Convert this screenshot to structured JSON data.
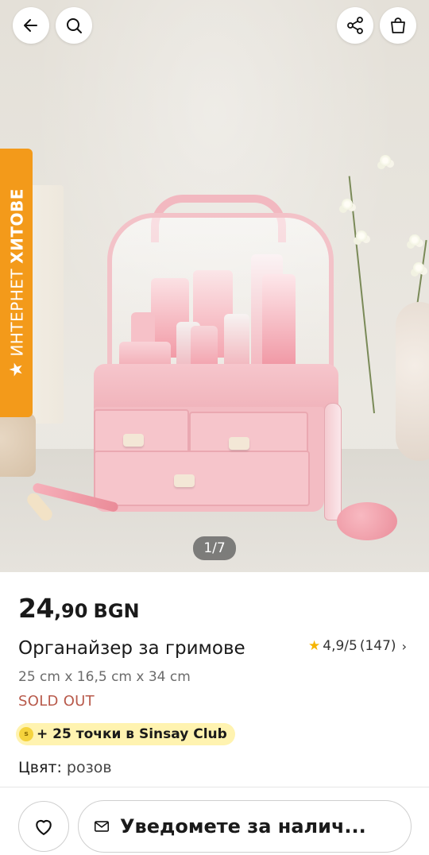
{
  "header": {
    "back_icon": "arrow-left-icon",
    "search_icon": "search-icon",
    "share_icon": "share-icon",
    "cart_icon": "shopping-bag-icon"
  },
  "gallery": {
    "badge_light": "ИНТЕРНЕТ",
    "badge_bold": "ХИТОВЕ",
    "badge_icon": "star-icon",
    "badge_color": "#f39a1a",
    "counter": "1/7",
    "product_color": "#f3bcc3"
  },
  "product": {
    "price_int": "24",
    "price_dec": ",90",
    "currency": "BGN",
    "title": "Органайзер за гримове",
    "rating": "4,9/5",
    "reviews": "(147)",
    "dimensions": "25 cm x 16,5 cm x 34 cm",
    "availability": "SOLD OUT",
    "club": "+ 25 точки в Sinsay Club",
    "color_label": "Цвят:",
    "color_value": "розов"
  },
  "actions": {
    "wishlist_icon": "heart-icon",
    "notify_icon": "mail-icon",
    "notify_label": "Уведомете за налич..."
  }
}
